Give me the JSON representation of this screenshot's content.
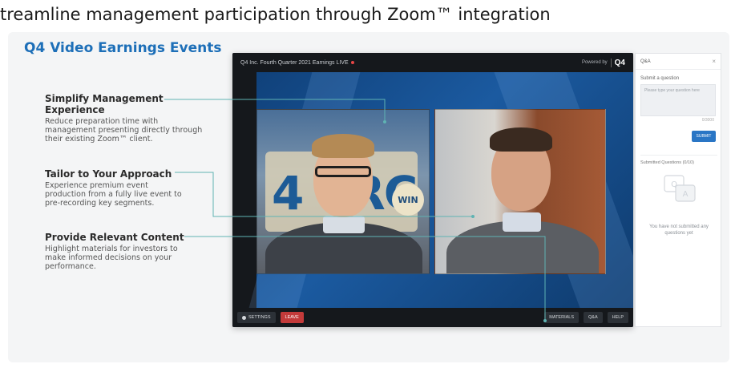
{
  "headline": "treamline management participation through Zoom™ integration",
  "section_title": "Q4 Video Earnings Events",
  "features": [
    {
      "title_line1": "Simplify Management",
      "title_line2": "Experience",
      "desc": "Reduce preparation time with management presenting directly through their existing  Zoom™ client."
    },
    {
      "title_line1": "Tailor to Your Approach",
      "desc": "Experience premium event production from a fully live event to pre-recording key segments."
    },
    {
      "title_line1": "Provide Relevant Content",
      "desc": "Highlight materials for investors to make informed decisions on your performance."
    }
  ],
  "player": {
    "title": "Q4 Inc. Fourth Quarter 2021 Earnings LIVE",
    "powered_by": "Powered by",
    "logo": "Q4",
    "poster_text": "4 CRC",
    "poster_badge": "WIN",
    "buttons": {
      "settings": "SETTINGS",
      "leave": "LEAVE",
      "materials": "MATERIALS",
      "qa": "Q&A",
      "help": "HELP"
    }
  },
  "qa_panel": {
    "title": "Q&A",
    "close": "×",
    "submit_label": "Submit a question",
    "input_placeholder": "Please type your question here",
    "char_count": "0/3000",
    "submit_button": "SUBMIT",
    "submitted_title": "Submitted Questions (0/10)",
    "empty_message": "You have not submitted any questions yet"
  },
  "colors": {
    "accent": "#1d6fb8",
    "connector": "#5fb3b3",
    "leave_button": "#c33a3a",
    "submit_button": "#2a76c5"
  },
  "icons": {
    "settings": "gear-icon",
    "close": "close-icon",
    "empty_questions": "chat-bubbles-icon"
  }
}
